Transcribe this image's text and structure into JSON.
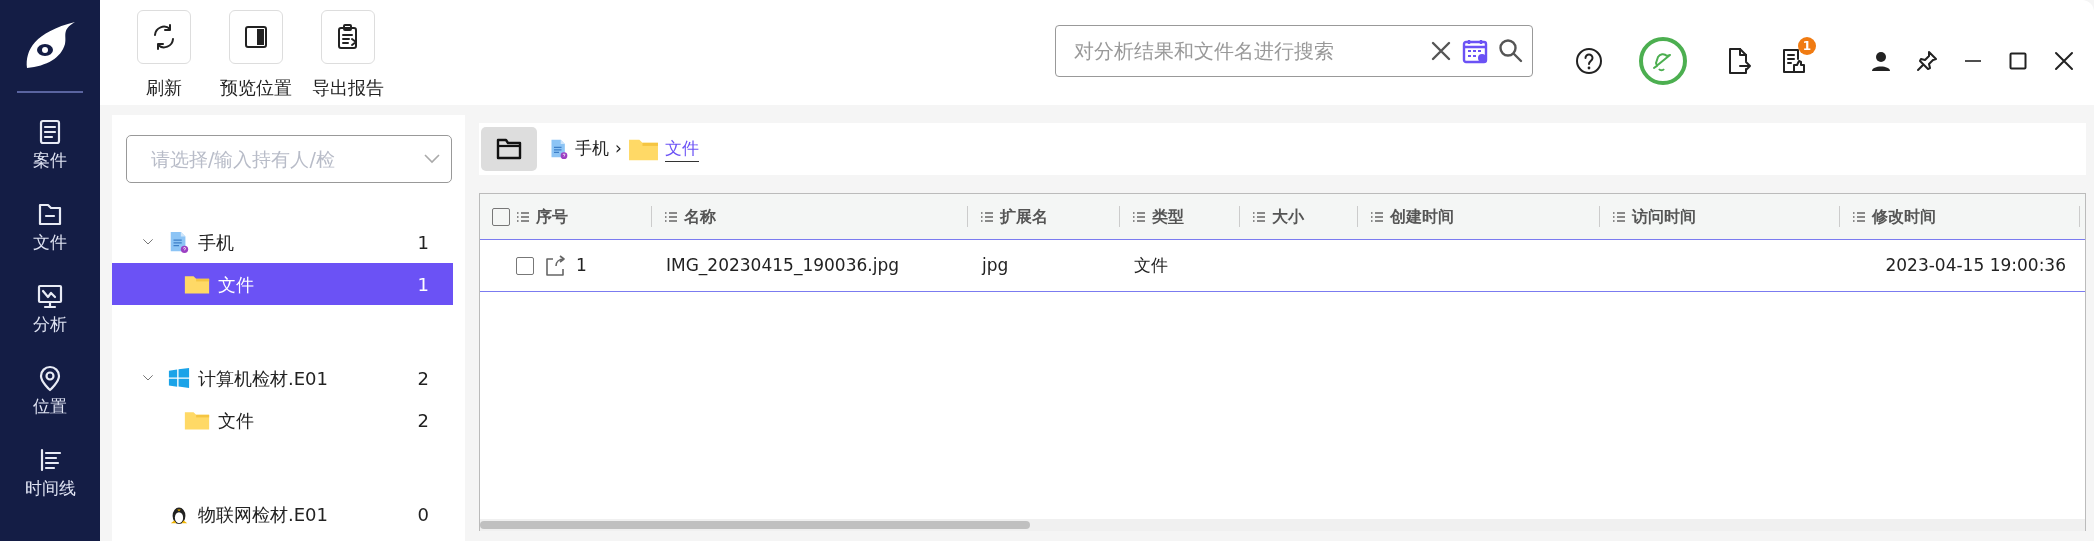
{
  "nav": {
    "items": [
      {
        "label": "案件"
      },
      {
        "label": "文件"
      },
      {
        "label": "分析"
      },
      {
        "label": "位置"
      },
      {
        "label": "时间线"
      }
    ]
  },
  "toolbar": {
    "buttons": [
      {
        "label": "刷新"
      },
      {
        "label": "预览位置"
      },
      {
        "label": "导出报告"
      }
    ]
  },
  "search": {
    "placeholder": "对分析结果和文件名进行搜索"
  },
  "header_actions": {
    "report_badge": "1"
  },
  "evidence_select": {
    "placeholder": "请选择/输入持有人/检"
  },
  "tree": [
    {
      "label": "手机",
      "count": "1",
      "kind": "phone",
      "expanded": true,
      "selected": false,
      "children": [
        {
          "label": "文件",
          "count": "1",
          "kind": "folder",
          "selected": true
        }
      ]
    },
    {
      "label": "计算机检材.E01",
      "count": "2",
      "kind": "windows",
      "expanded": true,
      "selected": false,
      "children": [
        {
          "label": "文件",
          "count": "2",
          "kind": "folder",
          "selected": false
        }
      ]
    },
    {
      "label": "物联网检材.E01",
      "count": "0",
      "kind": "linux",
      "selected": false
    }
  ],
  "breadcrumb": {
    "separator": "›",
    "items": [
      {
        "label": "手机",
        "kind": "phone",
        "current": false
      },
      {
        "label": "文件",
        "kind": "folder",
        "current": true
      }
    ]
  },
  "table": {
    "all_checked": false,
    "columns": [
      {
        "label": "序号"
      },
      {
        "label": "名称"
      },
      {
        "label": "扩展名"
      },
      {
        "label": "类型"
      },
      {
        "label": "大小"
      },
      {
        "label": "创建时间"
      },
      {
        "label": "访问时间"
      },
      {
        "label": "修改时间"
      }
    ],
    "rows": [
      {
        "checked": false,
        "index": "1",
        "name": "IMG_20230415_190036.jpg",
        "extension": "jpg",
        "type": "文件",
        "modified": "2023-04-15 19:00:36"
      }
    ]
  }
}
